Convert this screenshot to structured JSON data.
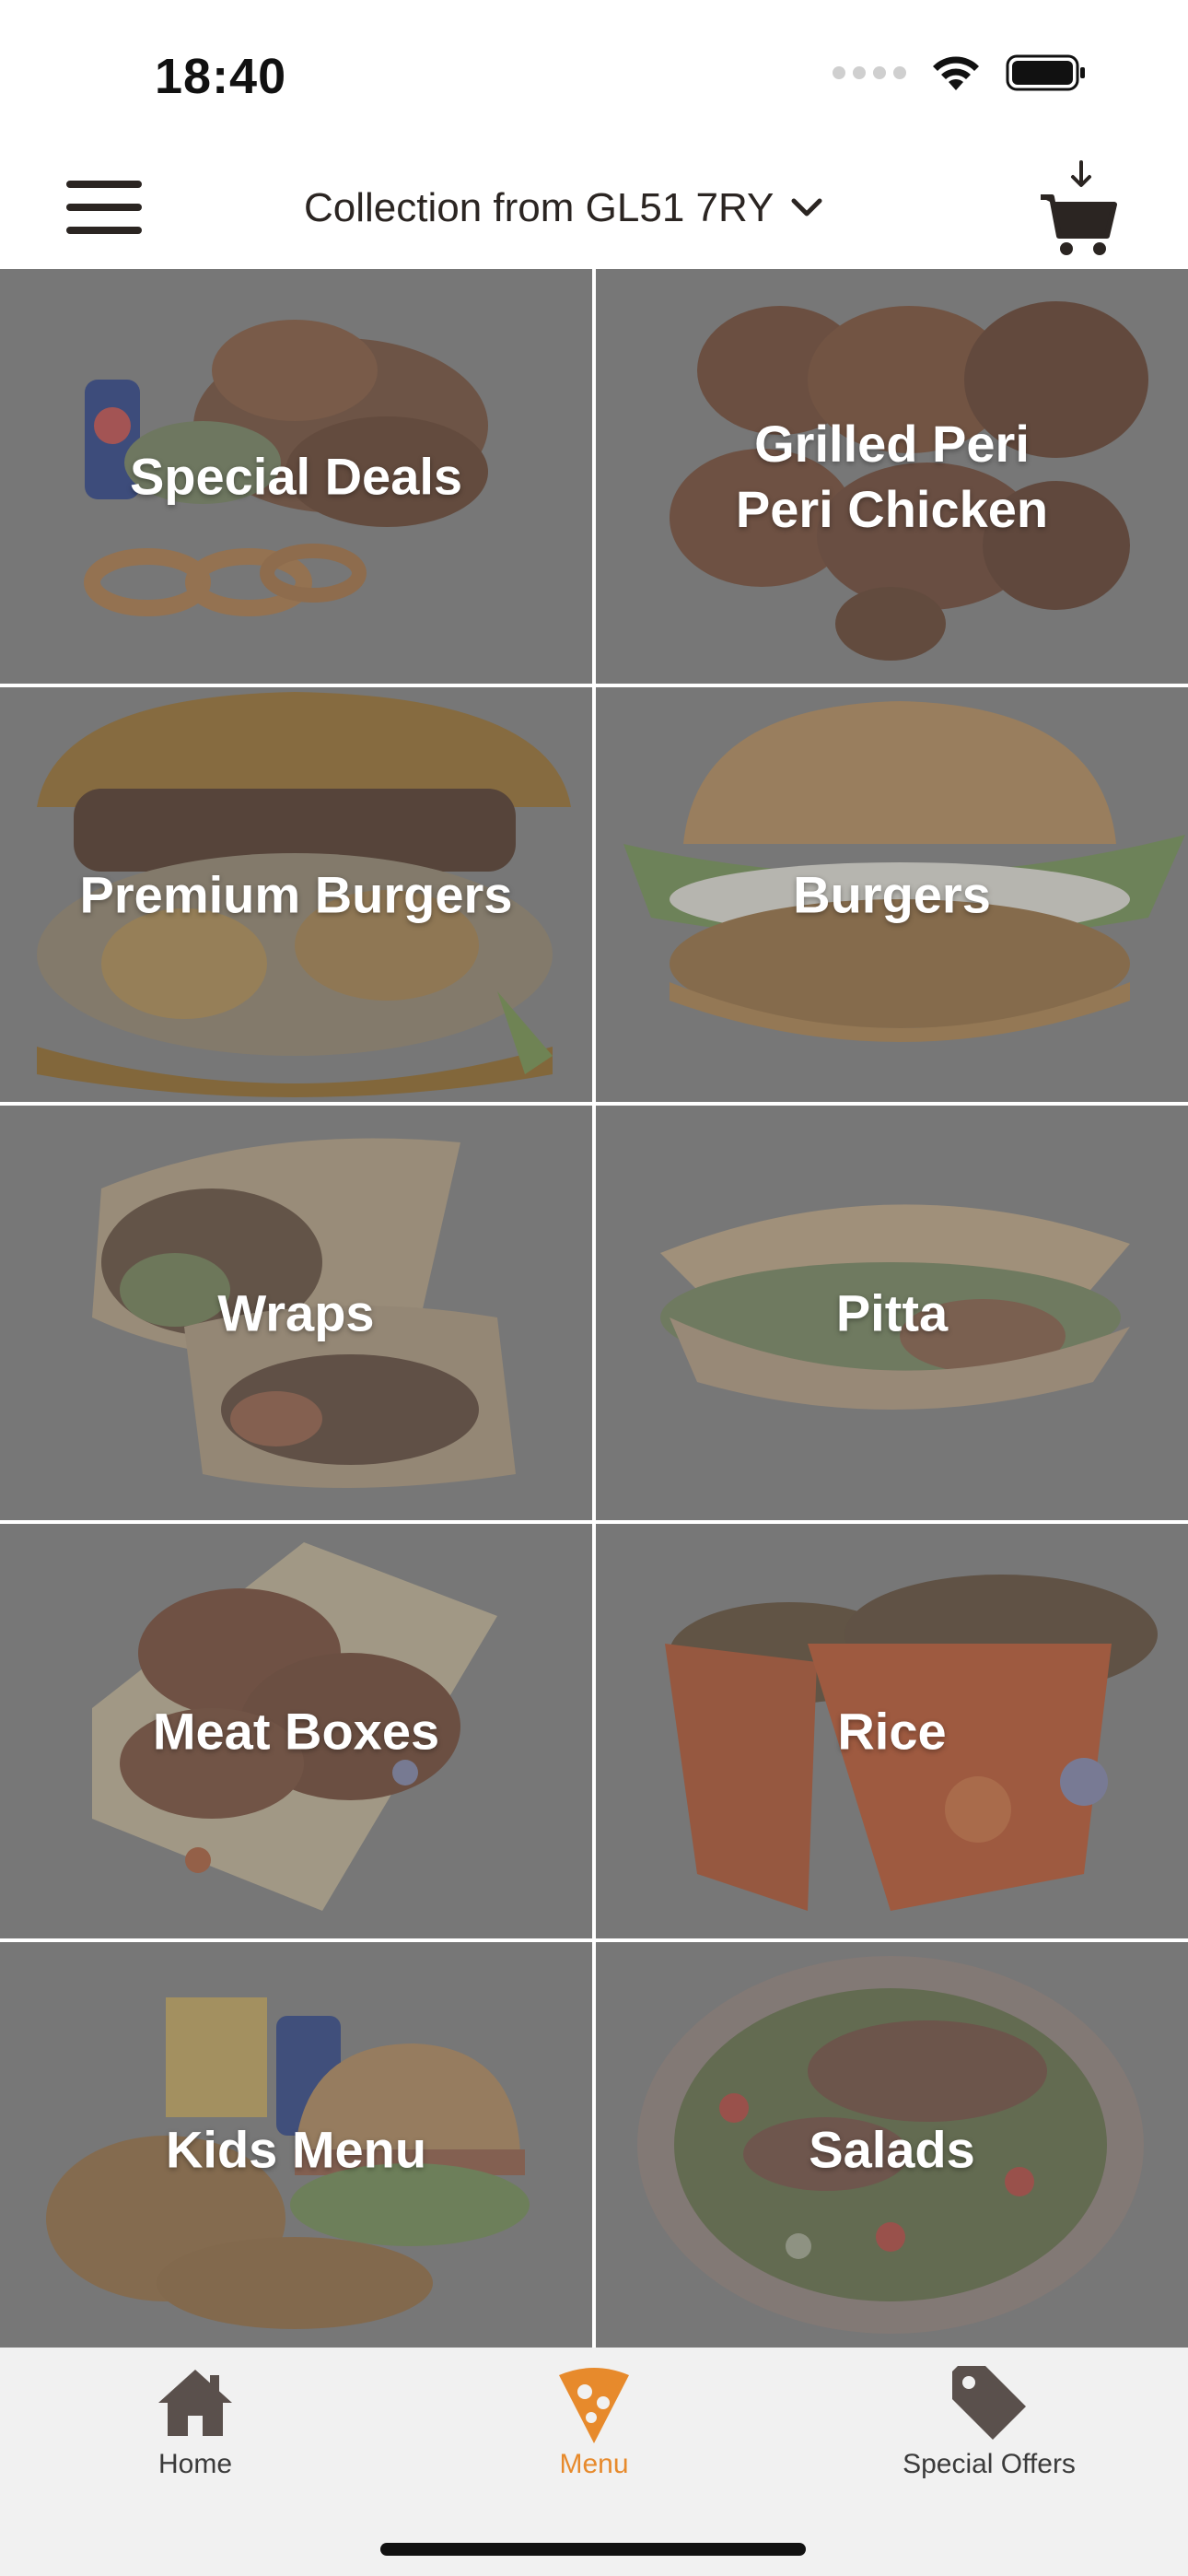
{
  "status_bar": {
    "time": "18:40"
  },
  "header": {
    "location_text": "Collection from GL51 7RY",
    "icons": {
      "menu": "hamburger-menu-icon",
      "dropdown": "chevron-down-icon",
      "cart": "shopping-cart-icon"
    }
  },
  "menu_categories": [
    {
      "label": "Special Deals"
    },
    {
      "label": "Grilled Peri\nPeri Chicken"
    },
    {
      "label": "Premium Burgers"
    },
    {
      "label": "Burgers"
    },
    {
      "label": "Wraps"
    },
    {
      "label": "Pitta"
    },
    {
      "label": "Meat Boxes"
    },
    {
      "label": "Rice"
    },
    {
      "label": "Kids Menu"
    },
    {
      "label": "Salads"
    }
  ],
  "tab_bar": {
    "tabs": [
      {
        "label": "Home",
        "icon": "home-icon"
      },
      {
        "label": "Menu",
        "icon": "pizza-slice-icon"
      },
      {
        "label": "Special Offers",
        "icon": "tag-icon"
      }
    ],
    "active_tab": "Menu"
  },
  "colors": {
    "accent": "#e78a2c",
    "tile_overlay": "#7a7a7a",
    "tab_bar_bg": "#f1f1f1",
    "icon_dark": "#5a504c"
  }
}
